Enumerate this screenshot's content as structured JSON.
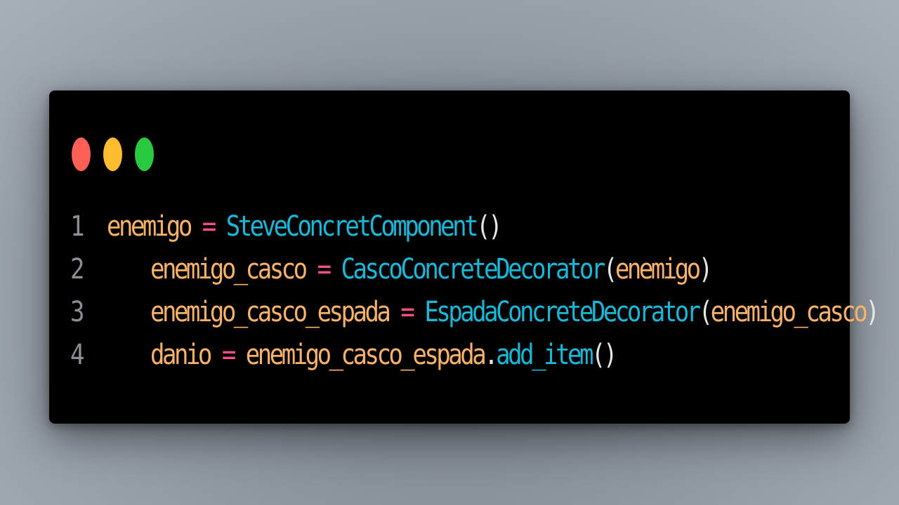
{
  "window": {
    "controls": [
      {
        "name": "close",
        "color": "#ff5f57"
      },
      {
        "name": "minimize",
        "color": "#febc2e"
      },
      {
        "name": "maximize",
        "color": "#28c840"
      }
    ]
  },
  "code": {
    "lines": [
      {
        "number": "1",
        "tokens": {
          "var": "enemigo",
          "op": " = ",
          "cls": "SteveConcretComponent",
          "pun": "()"
        }
      },
      {
        "number": "2",
        "tokens": {
          "var": "enemigo_casco",
          "op": " = ",
          "cls": "CascoConcreteDecorator",
          "open": "(",
          "arg": "enemigo",
          "close": ")"
        }
      },
      {
        "number": "3",
        "tokens": {
          "var": "enemigo_casco_espada",
          "op": " = ",
          "cls": "EspadaConcreteDecorator",
          "open": "(",
          "arg": "enemigo_casco",
          "close": ")"
        }
      },
      {
        "number": "4",
        "tokens": {
          "var": "danio",
          "op": " = ",
          "obj": "enemigo_casco_espada",
          "dot": ".",
          "fn": "add_item",
          "pun": "()"
        }
      }
    ]
  }
}
